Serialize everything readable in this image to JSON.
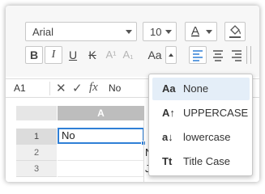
{
  "toolbar": {
    "font_family": "Arial",
    "font_size": "10",
    "font_color_glyph": "A",
    "bold_glyph": "B",
    "italic_glyph": "I",
    "underline_glyph": "U",
    "strike_glyph": "K",
    "superscript_glyph": "A¹",
    "subscript_glyph": "A₁",
    "text_case_glyph": "Aa",
    "accent_color": "#2f7fd6",
    "font_color": "#c00000"
  },
  "formula_bar": {
    "cell_reference": "A1",
    "function_glyph": "fx",
    "value": "No"
  },
  "sheet": {
    "column_header": "A",
    "rows": [
      {
        "number": "1",
        "value": "No"
      },
      {
        "number": "2",
        "value": ""
      },
      {
        "number": "3",
        "value": ""
      }
    ],
    "peek_row2": "N",
    "peek_row3": "J"
  },
  "text_case_menu": {
    "items": [
      {
        "icon": "Aa",
        "label": "None",
        "active": true
      },
      {
        "icon": "A↑",
        "label": "UPPERCASE"
      },
      {
        "icon": "a↓",
        "label": "lowercase"
      },
      {
        "icon": "Tt",
        "label": "Title Case"
      }
    ]
  }
}
